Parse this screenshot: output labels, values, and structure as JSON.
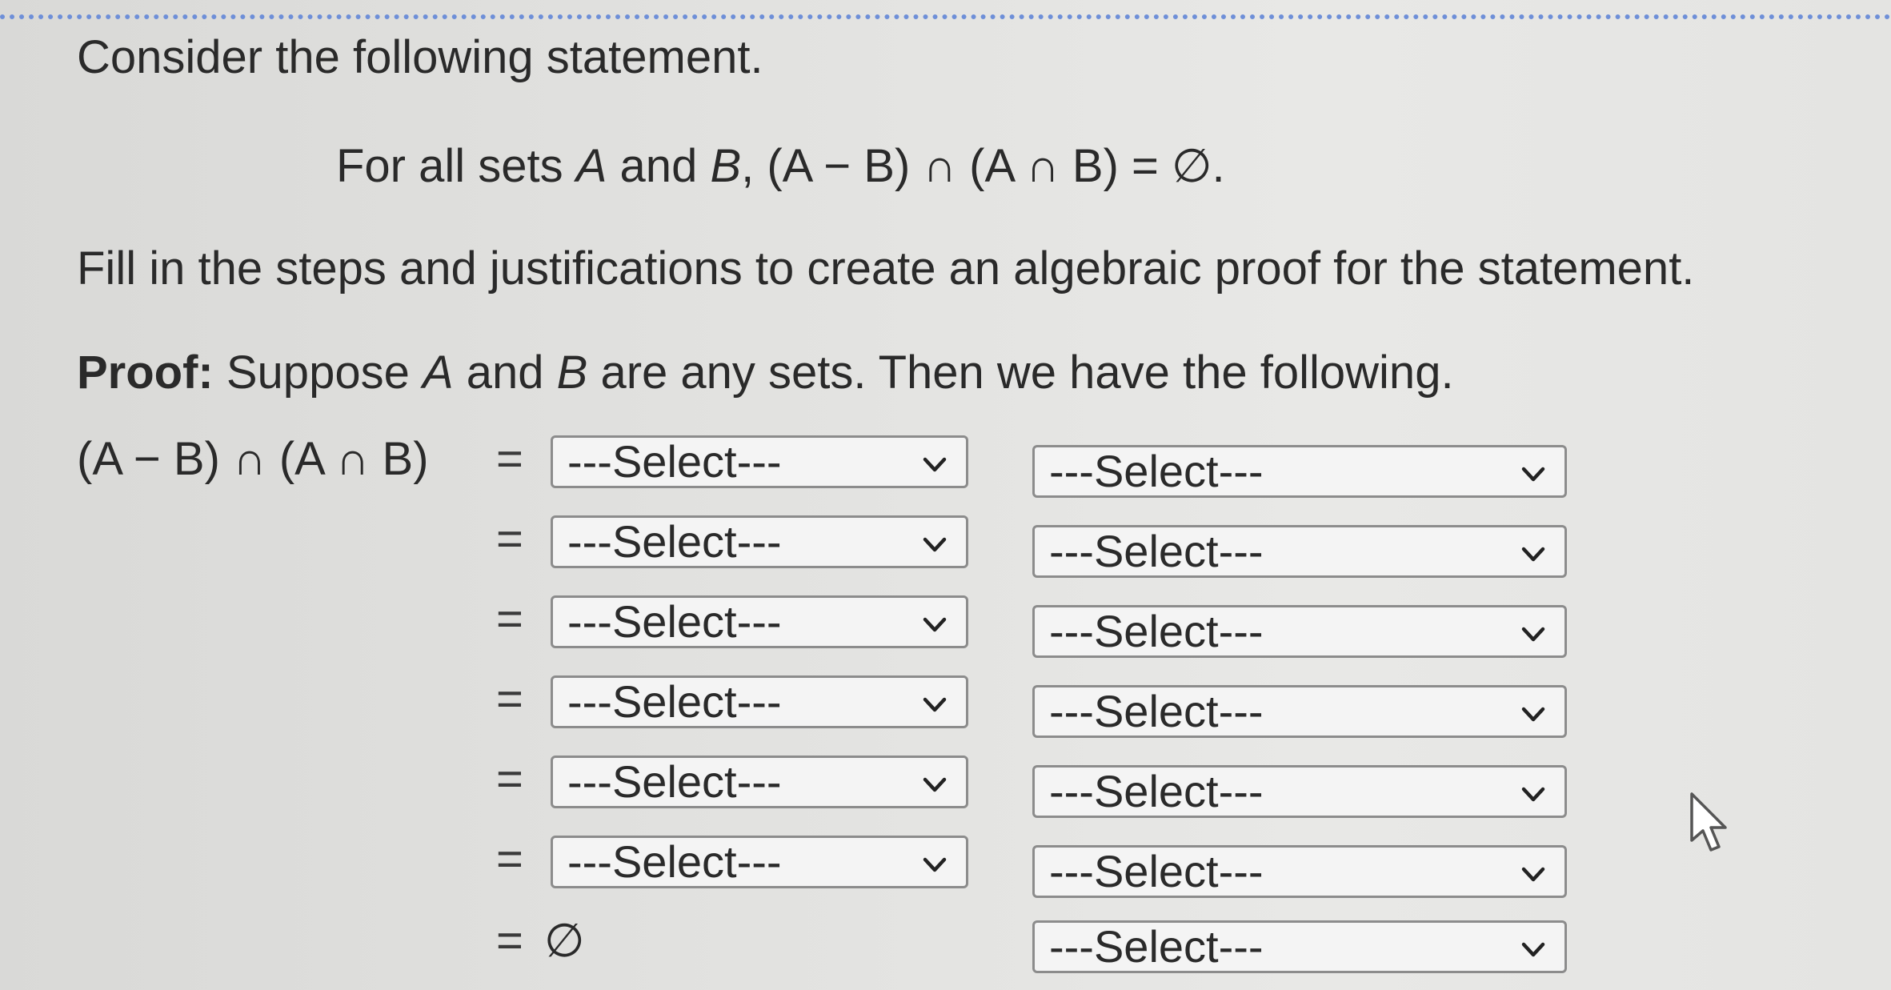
{
  "header": {
    "intro": "Consider the following statement."
  },
  "statement": {
    "prefix": "For all sets ",
    "var_a": "A",
    "and": " and ",
    "var_b": "B",
    "expression": ", (A − B) ∩ (A ∩ B) = ∅."
  },
  "instruction": "Fill in the steps and justifications to create an algebraic proof for the statement.",
  "proof": {
    "label": "Proof:",
    "text_before_a": " Suppose ",
    "var_a": "A",
    "and": " and ",
    "var_b": "B",
    "text_after": " are any sets. Then we have the following.",
    "lhs": "(A − B) ∩ (A ∩ B)",
    "equals_sign": "=",
    "final_value": "∅"
  },
  "steps": [
    {
      "step_select": "---Select---",
      "justification_select": "---Select---"
    },
    {
      "step_select": "---Select---",
      "justification_select": "---Select---"
    },
    {
      "step_select": "---Select---",
      "justification_select": "---Select---"
    },
    {
      "step_select": "---Select---",
      "justification_select": "---Select---"
    },
    {
      "step_select": "---Select---",
      "justification_select": "---Select---"
    },
    {
      "step_select": "---Select---",
      "justification_select": "---Select---"
    }
  ],
  "final_step": {
    "justification_select": "---Select---"
  },
  "icons": {
    "dropdown": "chevron-down-icon",
    "cursor": "mouse-pointer-icon"
  }
}
